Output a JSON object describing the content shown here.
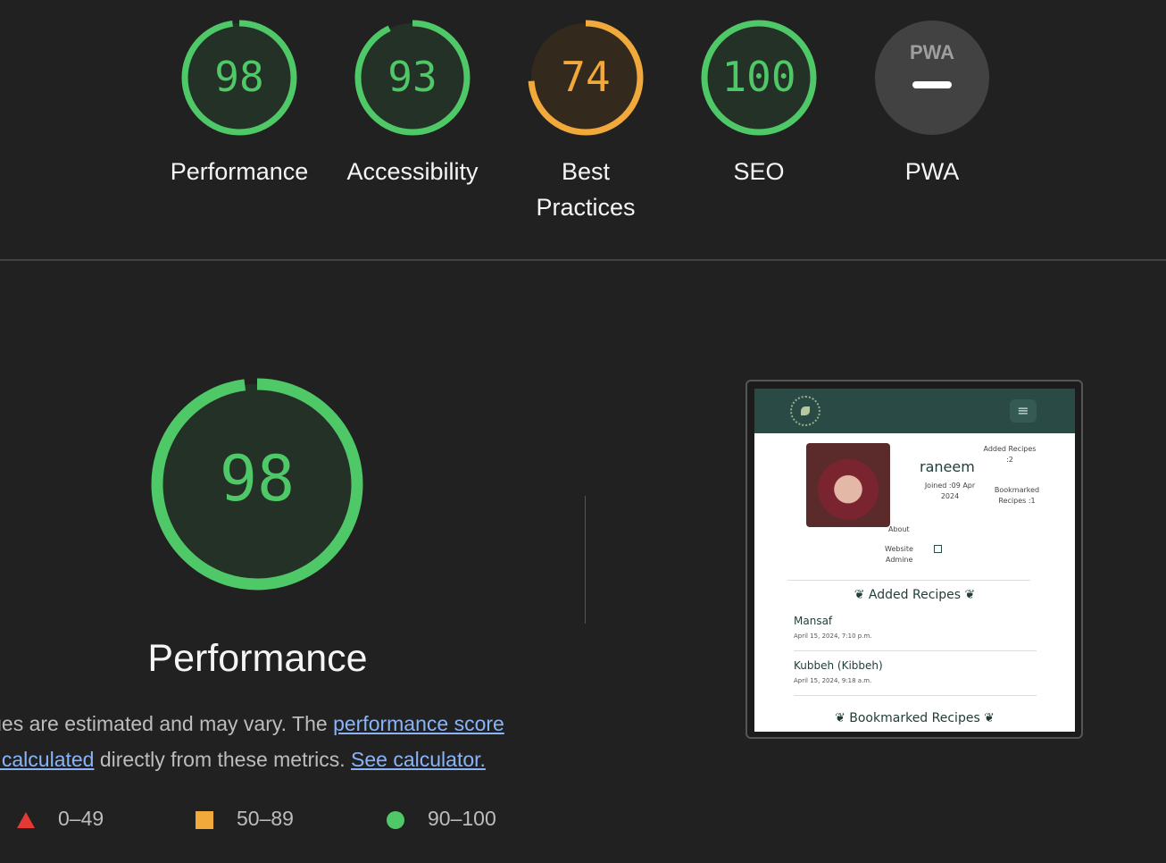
{
  "colors": {
    "pass": "#0cce6b",
    "pass_ring": "#4fc868",
    "average": "#f2a93b",
    "fail": "#e53935",
    "na": "#424242"
  },
  "gauges": [
    {
      "score": "98",
      "value": 98,
      "label": "Performance",
      "status": "pass"
    },
    {
      "score": "93",
      "value": 93,
      "label": "Accessibility",
      "status": "pass"
    },
    {
      "score": "74",
      "value": 74,
      "label_line1": "Best",
      "label_line2": "Practices",
      "status": "average"
    },
    {
      "score": "100",
      "value": 100,
      "label": "SEO",
      "status": "pass"
    },
    {
      "badge": "PWA",
      "label": "PWA",
      "status": "na"
    }
  ],
  "main": {
    "score": "98",
    "value": 98,
    "title": "Performance",
    "desc_prefix": "lues are estimated and may vary. The ",
    "link_score": "performance score",
    "link_calc_part": "s calculated",
    "desc_middle": " directly from these metrics. ",
    "link_calculator": "See calculator."
  },
  "legend": [
    {
      "icon": "triangle-icon",
      "range": "0–49"
    },
    {
      "icon": "square-icon",
      "range": "50–89"
    },
    {
      "icon": "circle-icon",
      "range": "90–100"
    }
  ],
  "thumbnail": {
    "username": "raneem",
    "joined": "Joined :09 Apr 2024",
    "added_label": "Added Recipes :2",
    "bookmarked_label": "Bookmarked Recipes :1",
    "about": "About",
    "website": "Website",
    "admin": "Admine",
    "section_added": "Added Recipes",
    "section_bookmarked": "Bookmarked Recipes",
    "recipes": [
      {
        "title": "Mansaf",
        "date": "April 15, 2024, 7:10 p.m."
      },
      {
        "title": "Kubbeh (Kibbeh)",
        "date": "April 15, 2024, 9:18 a.m."
      }
    ]
  }
}
